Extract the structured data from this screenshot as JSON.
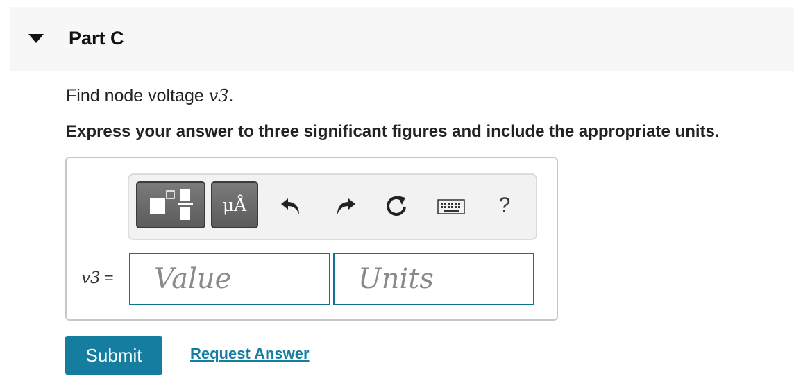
{
  "part": {
    "title": "Part C"
  },
  "question": {
    "text_prefix": "Find node voltage ",
    "variable": "v",
    "subscript": "3",
    "text_suffix": "."
  },
  "instruction": "Express your answer to three significant figures and include the appropriate units.",
  "toolbar": {
    "buttons": [
      {
        "name": "templates",
        "icon": "templates-icon"
      },
      {
        "name": "units",
        "label": "μÅ"
      },
      {
        "name": "undo",
        "icon": "undo-icon"
      },
      {
        "name": "redo",
        "icon": "redo-icon"
      },
      {
        "name": "reset",
        "icon": "reset-icon"
      },
      {
        "name": "keyboard",
        "icon": "keyboard-icon"
      },
      {
        "name": "help",
        "label": "?"
      }
    ]
  },
  "answer": {
    "variable": "v",
    "subscript": "3",
    "equals": " =",
    "value_placeholder": "Value",
    "units_placeholder": "Units"
  },
  "actions": {
    "submit_label": "Submit",
    "request_label": "Request Answer"
  },
  "colors": {
    "accent": "#157ea0",
    "field_border": "#0f7490",
    "header_bg": "#f7f7f7"
  }
}
